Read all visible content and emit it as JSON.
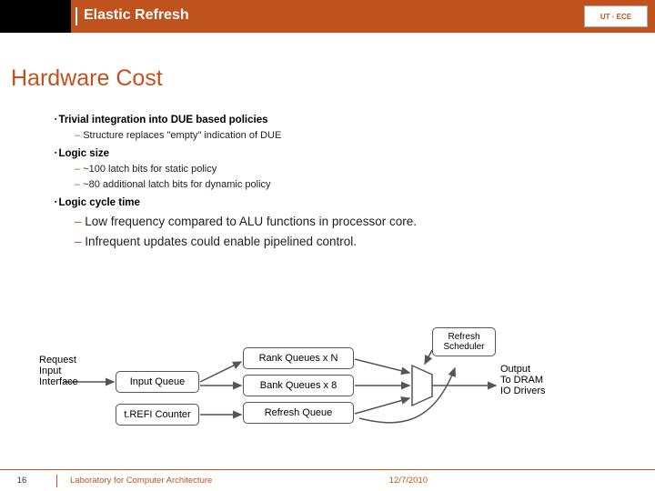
{
  "header": {
    "title": "Elastic Refresh",
    "logo_text": "UT · ECE"
  },
  "slide_title": "Hardware Cost",
  "content": {
    "b1": "Trivial integration into DUE based policies",
    "b1_1": "Structure replaces \"empty\" indication of DUE",
    "b2": "Logic size",
    "b2_1": "~100 latch bits for static policy",
    "b2_2": "~80 additional latch bits for dynamic policy",
    "b3": "Logic cycle time",
    "b3_1": "Low frequency compared to ALU functions in processor core.",
    "b3_2": "Infrequent updates could enable pipelined control."
  },
  "diagram": {
    "request_in": "Request\nInput\nInterface",
    "input_queue": "Input Queue",
    "trefi": "t.REFI Counter",
    "rank_q": "Rank Queues x N",
    "bank_q": "Bank Queues x 8",
    "refresh_q": "Refresh Queue",
    "refresh_sched": "Refresh\nScheduler",
    "output": "Output\nTo DRAM\nIO Drivers"
  },
  "footer": {
    "page": "16",
    "lab": "Laboratory for Computer Architecture",
    "date": "12/7/2010"
  }
}
